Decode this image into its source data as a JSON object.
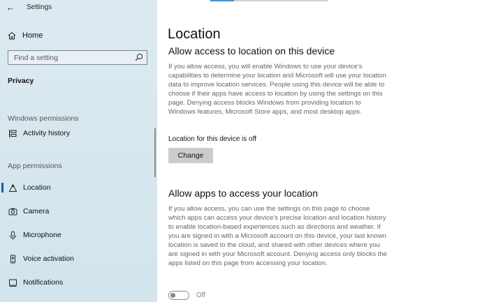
{
  "window": {
    "title": "Settings",
    "back_glyph": "←"
  },
  "sidebar": {
    "home_label": "Home",
    "search_placeholder": "Find a setting",
    "section": "Privacy",
    "windows_permissions_label": "Windows permissions",
    "app_permissions_label": "App permissions",
    "items": [
      {
        "label": "Activity history",
        "icon": "activity-history-icon"
      },
      {
        "label": "Location",
        "icon": "location-icon",
        "active": true
      },
      {
        "label": "Camera",
        "icon": "camera-icon"
      },
      {
        "label": "Microphone",
        "icon": "microphone-icon"
      },
      {
        "label": "Voice activation",
        "icon": "voice-activation-icon"
      },
      {
        "label": "Notifications",
        "icon": "notifications-icon"
      }
    ]
  },
  "main": {
    "title": "Location",
    "device_section": {
      "heading": "Allow access to location on this device",
      "description": "If you allow access, you will enable Windows to use your device's capabilities to determine your location and Microsoft will use your location data to improve location services. People using this device will be able to choose if their apps have access to location by using the settings on this page. Denying access blocks Windows from providing location to Windows features, Microsoft Store apps, and most desktop apps.",
      "status": "Location for this device is off",
      "change_button": "Change"
    },
    "apps_section": {
      "heading": "Allow apps to access your location",
      "description": "If you allow access, you can use the settings on this page to choose which apps can access your device's precise location and location history to enable location-based experiences such as directions and weather. If you are signed in with a Microsoft account on this device, your last known location is saved to the cloud, and shared with other devices where you are signed in with your Microsoft account. Denying access only blocks the apps listed on this page from accessing your location.",
      "toggle_state": "Off"
    }
  },
  "colors": {
    "sidebar_bg": "#d8e7ee",
    "accent": "#0063b1",
    "button_bg": "#cccccc"
  }
}
